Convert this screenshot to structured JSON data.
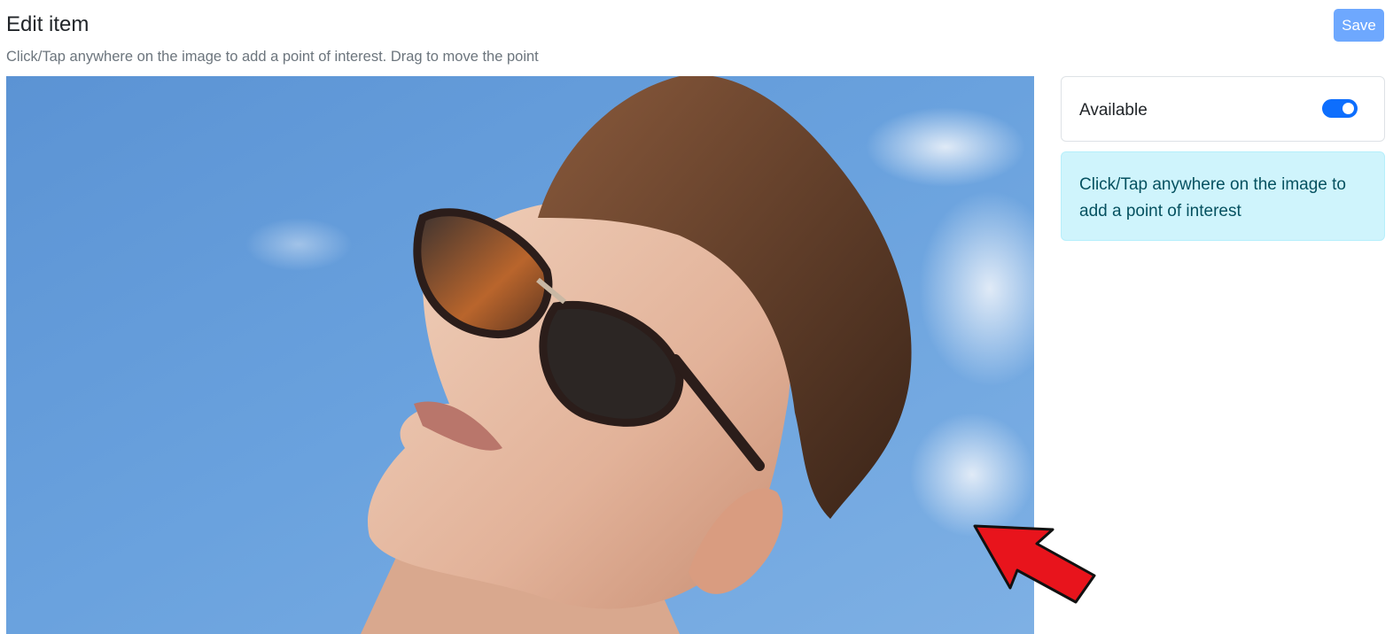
{
  "header": {
    "title": "Edit item",
    "subtitle": "Click/Tap anywhere on the image to add a point of interest. Drag to move the point",
    "save_label": "Save"
  },
  "sidebar": {
    "available_label": "Available",
    "available_on": true,
    "info_text": "Click/Tap anywhere on the image to add a point of interest"
  },
  "colors": {
    "primary": "#0d6efd",
    "save_disabled": "#6ea8fe",
    "info_bg": "#cff4fc",
    "info_text": "#055160",
    "annotation_arrow": "#e8141c"
  },
  "icons": {
    "arrow": "red-pointer-arrow-icon"
  }
}
